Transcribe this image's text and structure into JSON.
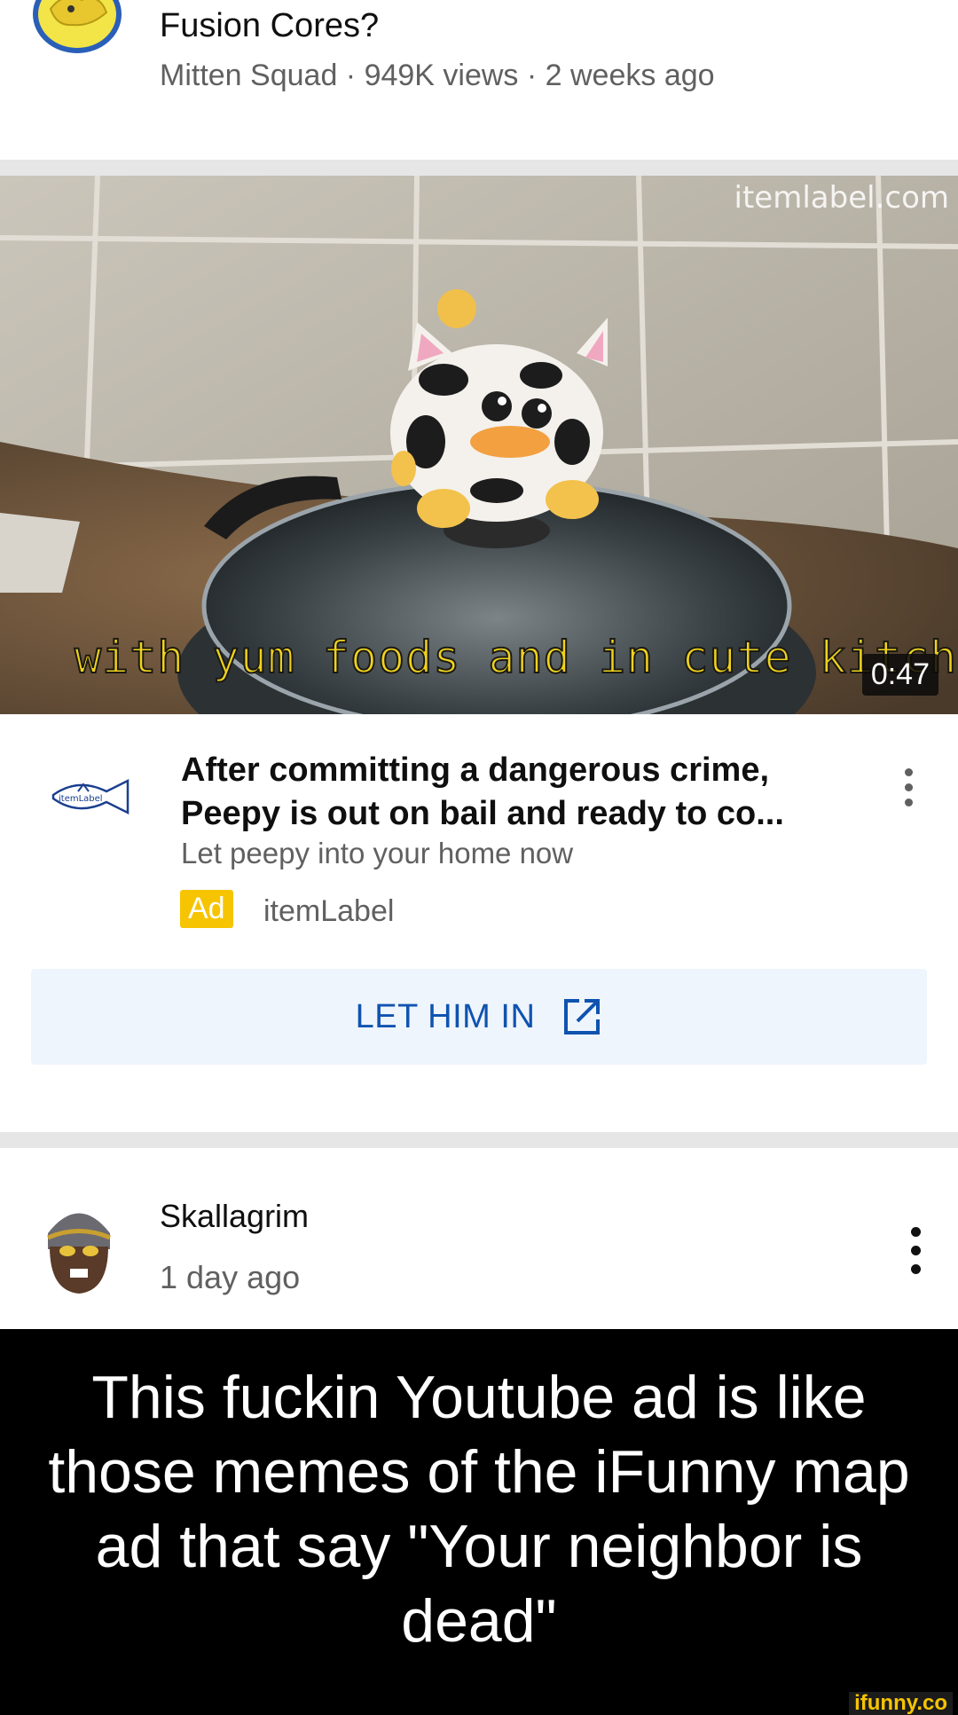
{
  "top_video": {
    "title": "Fusion Cores?",
    "meta": "Mitten Squad · 949K views · 2 weeks ago"
  },
  "ad": {
    "thumbnail": {
      "watermark": "itemlabel.com",
      "caption": "with yum foods and in cute kitch",
      "duration": "0:47"
    },
    "logo_text": "itemLabel",
    "title": "After committing a dangerous crime, Peepy is out on bail and ready to co...",
    "subtitle": "Let peepy into your home now",
    "badge": "Ad",
    "advertiser": "itemLabel",
    "cta_label": "LET HIM IN",
    "cta_icon": "external-link-icon",
    "badge_color": "#f6c400",
    "cta_color": "#0f53b0"
  },
  "comment": {
    "author": "Skallagrim",
    "time": "1 day ago"
  },
  "meme_caption": "This fuckin Youtube ad is like those memes of the iFunny map ad that say \"Your neighbor is dead\"",
  "watermark_corner": "ifunny.co"
}
